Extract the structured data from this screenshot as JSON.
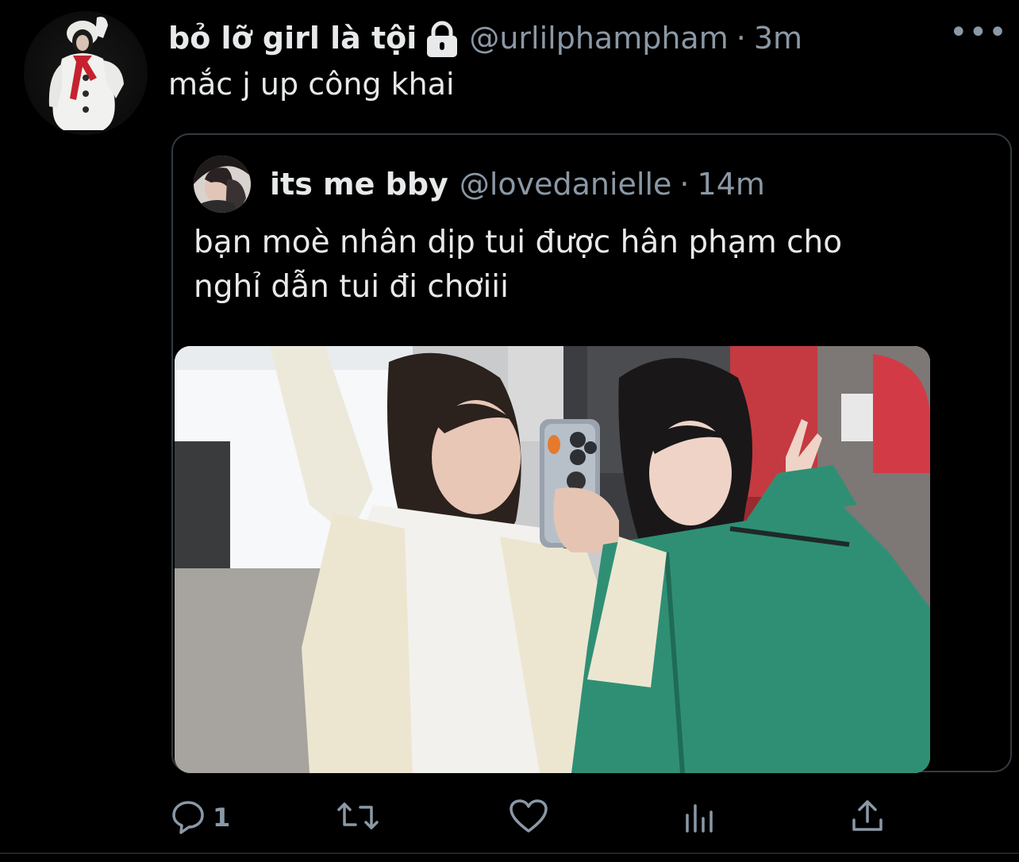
{
  "tweet": {
    "author_name": "bỏ lỡ girl là tội",
    "author_handle": "@urlilphampham",
    "separator": "·",
    "time": "3m",
    "more_label": "•••",
    "text": "mắc j up công khai",
    "avatar_icon": "profile-photo",
    "lock_icon": "lock-icon"
  },
  "quote": {
    "author_name": "its me bby",
    "author_handle": "@lovedanielle",
    "separator": "·",
    "time": "14m",
    "text_lines": [
      "bạn moè nhân dịp tui được hân phạm cho",
      "nghỉ dẫn tui đi chơiii"
    ]
  },
  "actions": {
    "reply_count": "1",
    "retweet_count": "",
    "like_count": "",
    "views_count": ""
  },
  "colors": {
    "background": "#000000",
    "text_primary": "#e7e9ea",
    "text_secondary": "#8b98a5",
    "border": "#333a40"
  }
}
